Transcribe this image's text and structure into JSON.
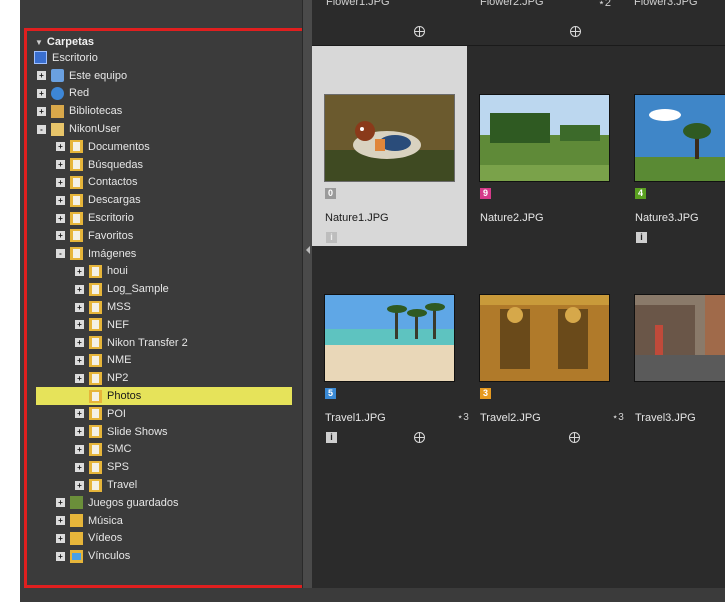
{
  "tree": {
    "header": "Carpetas",
    "items": [
      {
        "label": "Escritorio",
        "depth": 0,
        "expander": "",
        "icon": "desktop-icon"
      },
      {
        "label": "Este equipo",
        "depth": 1,
        "expander": "+",
        "icon": "computer-icon"
      },
      {
        "label": "Red",
        "depth": 1,
        "expander": "+",
        "icon": "network-icon"
      },
      {
        "label": "Bibliotecas",
        "depth": 1,
        "expander": "+",
        "icon": "library-icon"
      },
      {
        "label": "NikonUser",
        "depth": 1,
        "expander": "-",
        "icon": "user-folder-icon"
      },
      {
        "label": "Documentos",
        "depth": 2,
        "expander": "+",
        "icon": "folder-icon"
      },
      {
        "label": "Búsquedas",
        "depth": 2,
        "expander": "+",
        "icon": "folder-icon"
      },
      {
        "label": "Contactos",
        "depth": 2,
        "expander": "+",
        "icon": "folder-icon"
      },
      {
        "label": "Descargas",
        "depth": 2,
        "expander": "+",
        "icon": "folder-icon"
      },
      {
        "label": "Escritorio",
        "depth": 2,
        "expander": "+",
        "icon": "folder-icon"
      },
      {
        "label": "Favoritos",
        "depth": 2,
        "expander": "+",
        "icon": "folder-icon"
      },
      {
        "label": "Imágenes",
        "depth": 2,
        "expander": "-",
        "icon": "folder-icon"
      },
      {
        "label": "houi",
        "depth": 3,
        "expander": "+",
        "icon": "folder-icon"
      },
      {
        "label": "Log_Sample",
        "depth": 3,
        "expander": "+",
        "icon": "folder-icon"
      },
      {
        "label": "MSS",
        "depth": 3,
        "expander": "+",
        "icon": "folder-icon"
      },
      {
        "label": "NEF",
        "depth": 3,
        "expander": "+",
        "icon": "folder-icon"
      },
      {
        "label": "Nikon Transfer 2",
        "depth": 3,
        "expander": "+",
        "icon": "folder-icon"
      },
      {
        "label": "NME",
        "depth": 3,
        "expander": "+",
        "icon": "folder-icon"
      },
      {
        "label": "NP2",
        "depth": 3,
        "expander": "+",
        "icon": "folder-icon"
      },
      {
        "label": "Photos",
        "depth": 3,
        "expander": "",
        "icon": "folder-icon",
        "selected": true
      },
      {
        "label": "POI",
        "depth": 3,
        "expander": "+",
        "icon": "folder-icon"
      },
      {
        "label": "Slide Shows",
        "depth": 3,
        "expander": "+",
        "icon": "folder-icon"
      },
      {
        "label": "SMC",
        "depth": 3,
        "expander": "+",
        "icon": "folder-icon"
      },
      {
        "label": "SPS",
        "depth": 3,
        "expander": "+",
        "icon": "folder-icon"
      },
      {
        "label": "Travel",
        "depth": 3,
        "expander": "+",
        "icon": "folder-icon"
      },
      {
        "label": "Juegos guardados",
        "depth": 2,
        "expander": "+",
        "icon": "games-icon"
      },
      {
        "label": "Música",
        "depth": 2,
        "expander": "+",
        "icon": "music-icon"
      },
      {
        "label": "Vídeos",
        "depth": 2,
        "expander": "+",
        "icon": "video-icon"
      },
      {
        "label": "Vínculos",
        "depth": 2,
        "expander": "+",
        "icon": "links-icon"
      }
    ]
  },
  "top_row": {
    "names": [
      "Flower1.JPG",
      "Flower2.JPG",
      "Flower3.JPG"
    ],
    "stars": [
      "",
      "⋆2",
      ""
    ]
  },
  "thumbnails": [
    {
      "name": "Nature1.JPG",
      "label_num": "0",
      "label_color": "#9a9a9a",
      "selected": true,
      "star": "",
      "info": true,
      "geo": false,
      "image": "duck"
    },
    {
      "name": "Nature2.JPG",
      "label_num": "9",
      "label_color": "#d63a8a",
      "selected": false,
      "star": "",
      "info": false,
      "geo": false,
      "image": "trees"
    },
    {
      "name": "Nature3.JPG",
      "label_num": "4",
      "label_color": "#5aa020",
      "selected": false,
      "star": "",
      "info": true,
      "geo": false,
      "image": "sky"
    },
    {
      "name": "Travel1.JPG",
      "label_num": "5",
      "label_color": "#3a8ad6",
      "selected": false,
      "star": "⋆3",
      "info": true,
      "geo": true,
      "image": "beach"
    },
    {
      "name": "Travel2.JPG",
      "label_num": "3",
      "label_color": "#e69a20",
      "selected": false,
      "star": "⋆3",
      "info": false,
      "geo": true,
      "image": "temple"
    },
    {
      "name": "Travel3.JPG",
      "label_num": "",
      "label_color": "",
      "selected": false,
      "star": "",
      "info": false,
      "geo": false,
      "image": "street"
    }
  ],
  "colors": {
    "panel_bg": "#3b3b3b",
    "grid_bg": "#2b2b2b",
    "highlight_frame": "#e01f1f",
    "selection_yellow": "#e6e35a"
  }
}
